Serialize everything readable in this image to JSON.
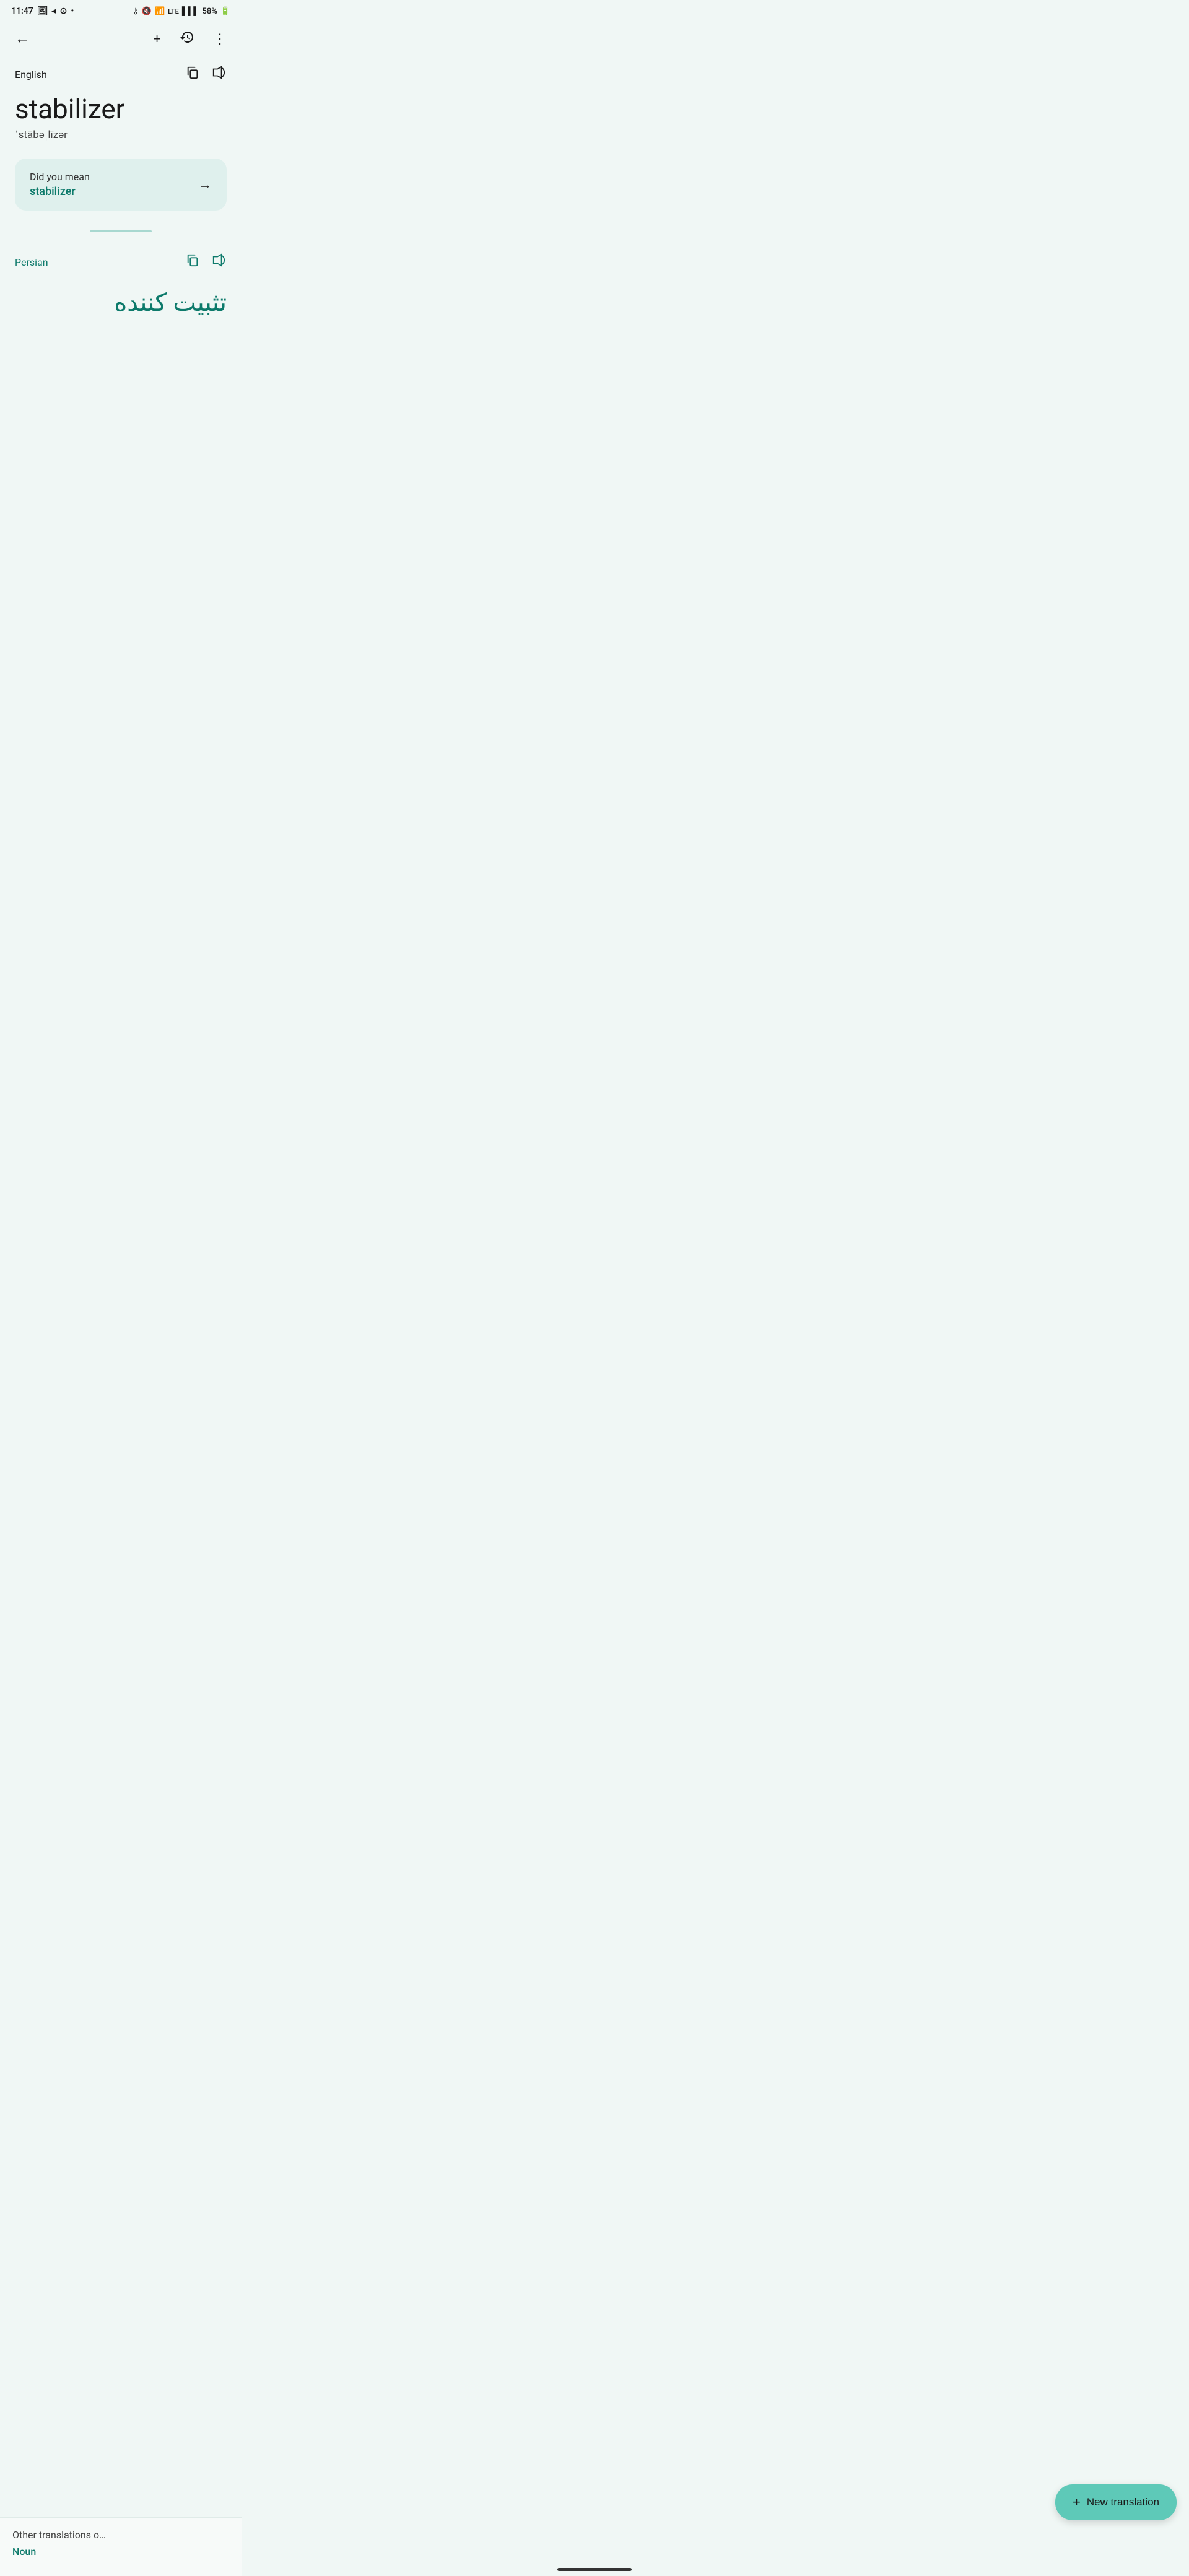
{
  "statusBar": {
    "time": "11:47",
    "batteryPercent": "58%",
    "icons": {
      "photo": "🖼",
      "nav": "◀",
      "whatsapp": "●",
      "dot": "•",
      "key": "🔑",
      "mute": "🔇",
      "wifi": "WiFi",
      "lte": "LTE",
      "signal": "▌▌▌",
      "battery": "🔋"
    }
  },
  "topNav": {
    "backLabel": "←",
    "addLabel": "+",
    "historyLabel": "⟳",
    "moreLabel": "⋮"
  },
  "source": {
    "language": "English",
    "word": "stabilizer",
    "phonetic": "ˈstābəˌlīzər",
    "copyTitle": "Copy",
    "volumeTitle": "Listen"
  },
  "suggestion": {
    "promptText": "Did you mean",
    "word": "stabilizer",
    "arrowLabel": "→"
  },
  "target": {
    "language": "Persian",
    "translation": "تثبیت کننده",
    "copyTitle": "Copy",
    "volumeTitle": "Listen"
  },
  "bottomBar": {
    "otherTranslationsLabel": "Other translations o",
    "posLabel": "Noun"
  },
  "fab": {
    "plusIcon": "+",
    "label": "New translation"
  }
}
